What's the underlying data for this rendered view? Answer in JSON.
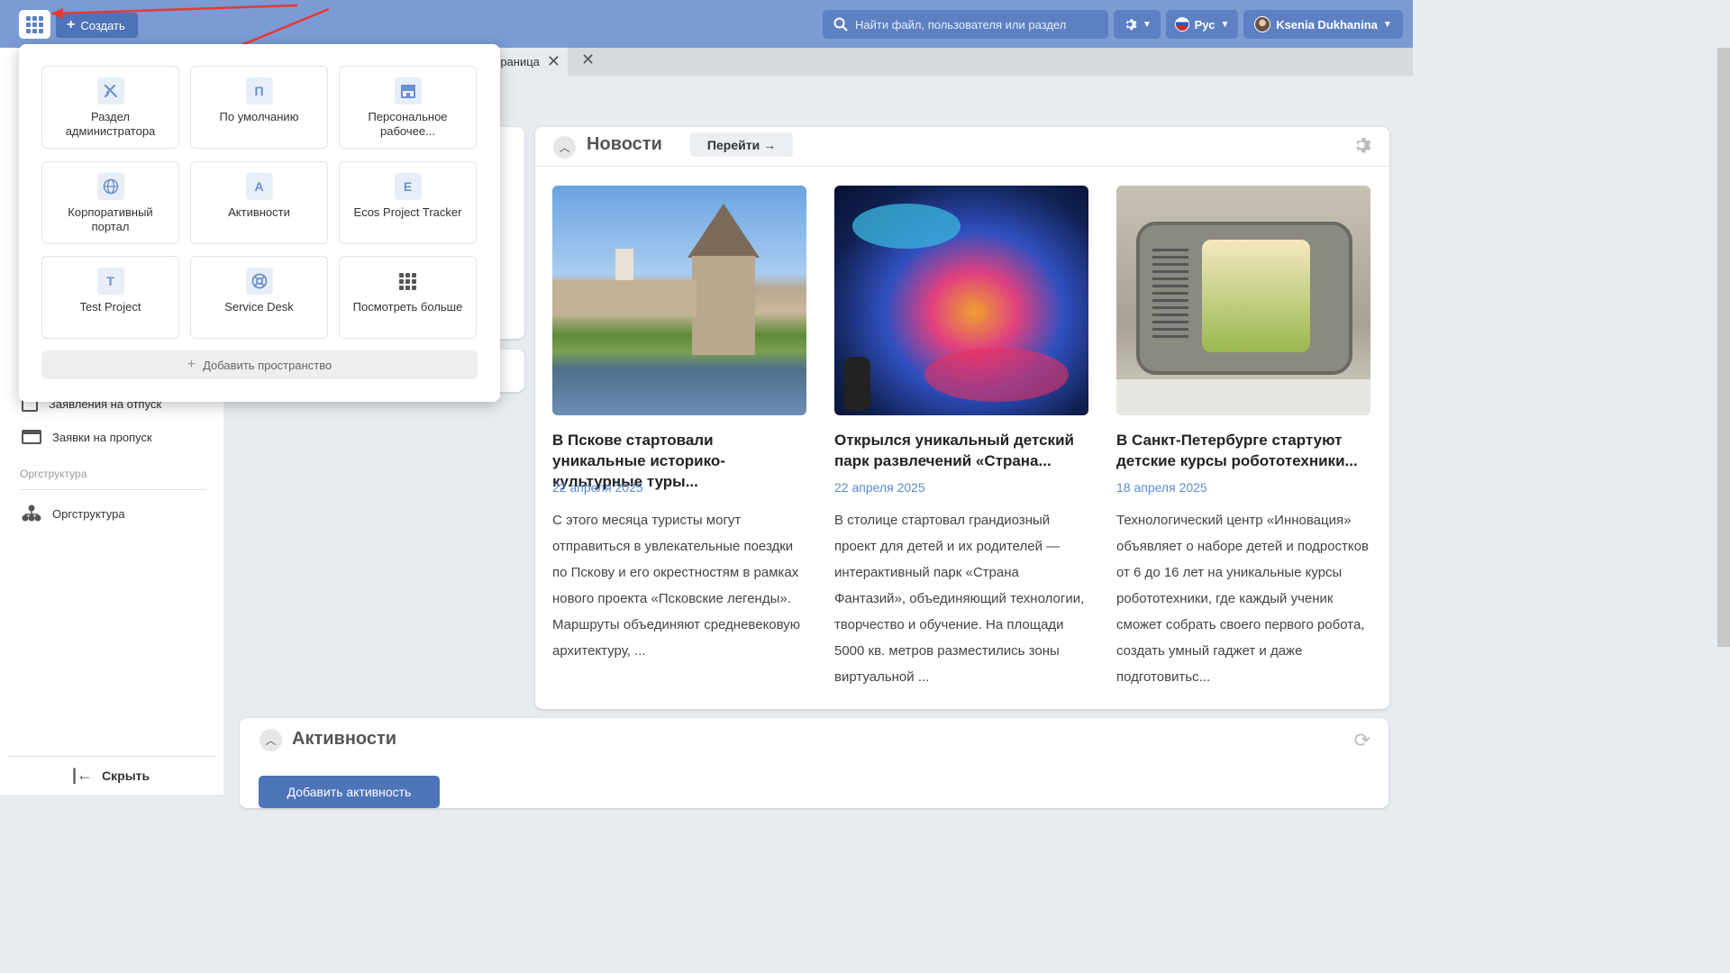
{
  "topbar": {
    "create_label": "Создать",
    "search_placeholder": "Найти файл, пользователя или раздел",
    "language": "Рус",
    "user": "Ksenia Dukhanina"
  },
  "tabs": {
    "partial_label": "раница"
  },
  "apps_menu": {
    "tiles": [
      {
        "icon": "tools-icon",
        "letter": "",
        "label": "Раздел администратора"
      },
      {
        "icon": "letter-icon",
        "letter": "П",
        "label": "По умолчанию"
      },
      {
        "icon": "store-icon",
        "letter": "",
        "label": "Персональное рабочее..."
      },
      {
        "icon": "globe-icon",
        "letter": "",
        "label": "Корпоративный портал"
      },
      {
        "icon": "letter-icon",
        "letter": "А",
        "label": "Активности"
      },
      {
        "icon": "letter-icon",
        "letter": "E",
        "label": "Ecos Project Tracker"
      },
      {
        "icon": "letter-icon",
        "letter": "T",
        "label": "Test Project"
      },
      {
        "icon": "lifebuoy-icon",
        "letter": "",
        "label": "Service Desk"
      },
      {
        "icon": "grid-icon",
        "letter": "",
        "label": "Посмотреть больше"
      }
    ],
    "add_space": "Добавить пространство"
  },
  "sidebar": {
    "items": [
      {
        "label": "Заявления на отпуск"
      },
      {
        "label": "Заявки на пропуск"
      }
    ],
    "section": "Оргструктура",
    "org_item": "Оргструктура",
    "hide_label": "Скрыть"
  },
  "news": {
    "title": "Новости",
    "goto_label": "Перейти →",
    "articles": [
      {
        "title": "В Пскове стартовали уникальные историко-культурные туры...",
        "date": "22 апреля 2025",
        "text": "С этого месяца туристы могут отправиться в увлекательные поездки по Пскову и его окрестностям в рамках нового проекта «Псковские легенды». Маршруты объединяют средневековую архитектуру, ..."
      },
      {
        "title": "Открылся уникальный детский парк развлечений «Страна...",
        "date": "22 апреля 2025",
        "text": "В столице стартовал грандиозный проект для детей и их родителей — интерактивный парк «Страна Фантазий», объединяющий технологии, творчество и обучение. На площади 5000 кв. метров разместились зоны виртуальной ..."
      },
      {
        "title": "В Санкт-Петербурге стартуют детские курсы робототехники...",
        "date": "18 апреля 2025",
        "text": "Технологический центр «Инновация» объявляет о наборе детей и подростков от 6 до 16 лет на уникальные курсы робототехники, где каждый ученик сможет собрать своего первого робота, создать умный гаджет и даже подготовитьс..."
      }
    ]
  },
  "activities": {
    "title": "Активности",
    "add_label": "Добавить активность"
  },
  "colors": {
    "topbar": "#7b9bd4",
    "accent": "#4d74b8",
    "date": "#5b8ad1"
  }
}
